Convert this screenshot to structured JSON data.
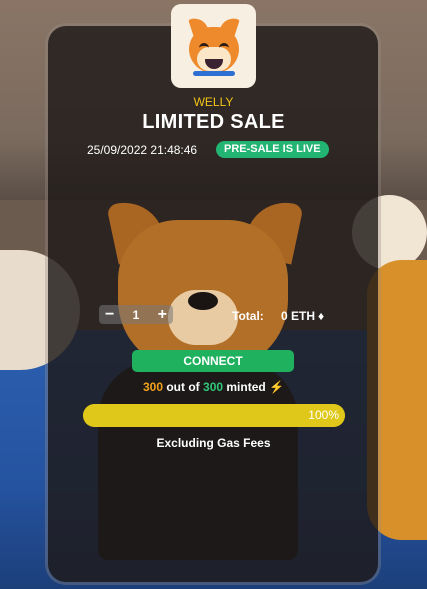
{
  "brand": "WELLY",
  "title": "LIMITED SALE",
  "datetime": "25/09/2022 21:48:46",
  "status_badge": "PRE-SALE IS LIVE",
  "stepper": {
    "minus": "−",
    "quantity": "1",
    "plus": "+"
  },
  "total": {
    "label": "Total:",
    "value": "0 ETH",
    "icon": "eth-icon"
  },
  "connect_label": "CONNECT",
  "minted": {
    "count": "300",
    "out_of": "out of",
    "max": "300",
    "suffix": "minted",
    "icon": "lightning-icon"
  },
  "progress": {
    "fraction": 1.0,
    "label": "100%"
  },
  "gas_note": "Excluding Gas Fees",
  "colors": {
    "accent_yellow": "#f3c316",
    "badge_green": "#22b472",
    "connect_green": "#20b15f",
    "progress_yellow": "#e0c81a",
    "minted_orange": "#f2a21a",
    "minted_green": "#2ec978"
  }
}
